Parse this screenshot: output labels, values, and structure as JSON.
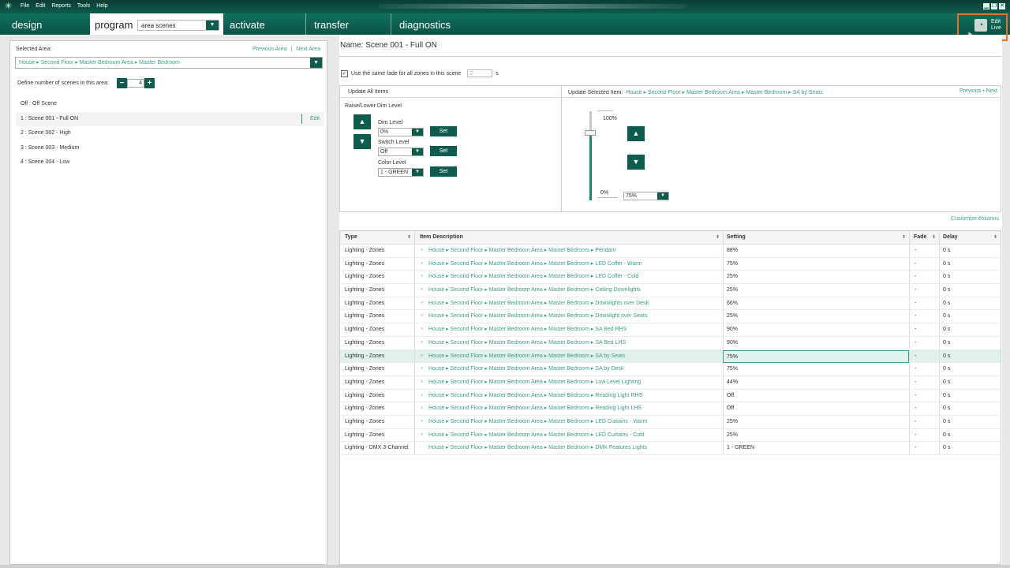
{
  "menubar": {
    "logo": "✳",
    "items": [
      "File",
      "Edit",
      "Reports",
      "Tools",
      "Help"
    ],
    "window_buttons": [
      "▁",
      "❐",
      "✕"
    ]
  },
  "tabs": {
    "design": "design",
    "program": "program",
    "mode_select": "area scenes",
    "activate": "activate",
    "transfer": "transfer",
    "diagnostics": "diagnostics"
  },
  "edit_live": {
    "line1": "Edit",
    "line2": "Live",
    "icon": "wifi-icon"
  },
  "left": {
    "selected_area_label": "Selected Area:",
    "previous_area": "Previous Area",
    "separator": "|",
    "next_area": "Next Area",
    "area_path": "House ▸ Second Floor ▸ Master Bedroom Area ▸ Master Bedroom",
    "define_label": "Define number of scenes in this area:",
    "scene_count": "4",
    "minus": "−",
    "plus": "+",
    "scenes": [
      {
        "text": "Off  :  Off Scene"
      },
      {
        "text": "1  :  Scene 001 - Full ON"
      },
      {
        "text": "2  :  Scene 002 - High"
      },
      {
        "text": "3  :  Scene 003 - Medium"
      },
      {
        "text": "4  :  Scene 004 - Low"
      }
    ],
    "edit_label": "Edit"
  },
  "right": {
    "name_label": "Name:  Scene 001 - Full ON",
    "same_fade_label": "Use the same fade for all zones in this scene",
    "fade_value": "2",
    "fade_unit": "s",
    "update_all_title": "Update All Items",
    "update_selected_title": "Update Selected Item:",
    "selected_path": "House ▸ Second Floor ▸ Master Bedroom Area ▸ Master Bedroom ▸ SA by Seats",
    "previous": "Previous",
    "dot": "•",
    "next": "Next",
    "raise_lower_label": "Raise/Lower Dim Level",
    "dim_level_label": "Dim Level",
    "dim_level_value": "0%",
    "switch_level_label": "Switch Level",
    "switch_level_value": "Off",
    "color_level_label": "Color Level",
    "color_level_value": "1 - GREEN",
    "set_label": "Set",
    "slider_top": "100%",
    "slider_bottom": "0%",
    "slider_value": "75%",
    "slider_level": 0.75,
    "customize_columns": "Customize columns"
  },
  "grid": {
    "headers": [
      "Type",
      "Item Description",
      "Setting",
      "Fade",
      "Delay"
    ],
    "sort_glyph": "⬍",
    "path_prefix": "House ▸ Second Floor ▸ Master Bedroom Area ▸ Master Bedroom ▸",
    "rows": [
      {
        "type": "Lighting - Zones",
        "icon": "bulb-icon",
        "item": "Pendant",
        "setting": "88%",
        "fade": "-",
        "delay": "0 s"
      },
      {
        "type": "Lighting - Zones",
        "icon": "bulb-icon",
        "item": "LED  Coffer - Warm",
        "setting": "75%",
        "fade": "-",
        "delay": "0 s"
      },
      {
        "type": "Lighting - Zones",
        "icon": "bulb-icon",
        "item": "LED  Coffer - Cold",
        "setting": "25%",
        "fade": "-",
        "delay": "0 s"
      },
      {
        "type": "Lighting - Zones",
        "icon": "bulb-icon",
        "item": "Ceiling Downlights",
        "setting": "25%",
        "fade": "-",
        "delay": "0 s"
      },
      {
        "type": "Lighting - Zones",
        "icon": "bulb-icon",
        "item": "Downlights over Desk",
        "setting": "66%",
        "fade": "-",
        "delay": "0 s"
      },
      {
        "type": "Lighting - Zones",
        "icon": "bulb-icon",
        "item": "Downlight over Seats",
        "setting": "25%",
        "fade": "-",
        "delay": "0 s"
      },
      {
        "type": "Lighting - Zones",
        "icon": "bulb-icon",
        "item": "SA Bed RHS",
        "setting": "90%",
        "fade": "-",
        "delay": "0 s"
      },
      {
        "type": "Lighting - Zones",
        "icon": "bulb-icon",
        "item": "SA Bed LHS",
        "setting": "90%",
        "fade": "-",
        "delay": "0 s"
      },
      {
        "type": "Lighting - Zones",
        "icon": "bulb-icon",
        "item": "SA by Seats",
        "setting": "75%",
        "fade": "-",
        "delay": "0 s",
        "selected": true
      },
      {
        "type": "Lighting - Zones",
        "icon": "bulb-icon",
        "item": "SA by Desk",
        "setting": "75%",
        "fade": "-",
        "delay": "0 s"
      },
      {
        "type": "Lighting - Zones",
        "icon": "bulb-icon",
        "item": "Low Level Lighting",
        "setting": "44%",
        "fade": "-",
        "delay": "0 s"
      },
      {
        "type": "Lighting - Zones",
        "icon": "lamp-icon",
        "item": "Reading Light RHS",
        "setting": "Off",
        "fade": "-",
        "delay": "0 s"
      },
      {
        "type": "Lighting - Zones",
        "icon": "lamp-icon",
        "item": "Reading Light LHS",
        "setting": "Off",
        "fade": "-",
        "delay": "0 s"
      },
      {
        "type": "Lighting - Zones",
        "icon": "bulb-icon",
        "item": "LED Curtains - Warm",
        "setting": "25%",
        "fade": "-",
        "delay": "0 s"
      },
      {
        "type": "Lighting - Zones",
        "icon": "bulb-icon",
        "item": "LED Curtains - Cold",
        "setting": "25%",
        "fade": "-",
        "delay": "0 s"
      },
      {
        "type": "Lighting - DMX 3-Channel",
        "icon": "sliders-icon",
        "item": "DMX Features Lights",
        "setting": "1 - GREEN",
        "fade": "-",
        "delay": "0 s"
      }
    ]
  },
  "colors": {
    "accent": "#0f5c4f",
    "link": "#3c9d8b",
    "highlight": "#f07023"
  }
}
